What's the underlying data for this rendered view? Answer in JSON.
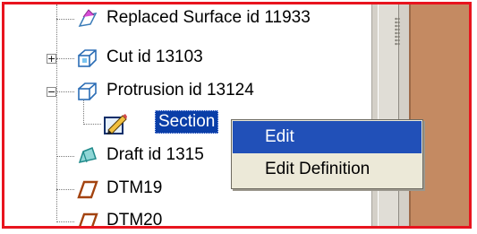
{
  "tree": {
    "items": [
      {
        "label": "Replaced Surface id 11933",
        "icon": "replaced-surface-icon"
      },
      {
        "label": "Cut id 13103",
        "icon": "cut-feature-icon",
        "expander": "+"
      },
      {
        "label": "Protrusion id 13124",
        "icon": "protrusion-feature-icon",
        "expander": "−"
      },
      {
        "label": "Section",
        "icon": "section-sketch-icon",
        "selected": true
      },
      {
        "label": "Draft id 1315",
        "icon": "draft-feature-icon"
      },
      {
        "label": "DTM19",
        "icon": "datum-plane-icon"
      },
      {
        "label": "DTM20",
        "icon": "datum-plane-icon"
      }
    ]
  },
  "context_menu": {
    "items": [
      {
        "label": "Edit",
        "highlighted": true
      },
      {
        "label": "Edit Definition",
        "highlighted": false
      }
    ]
  },
  "colors": {
    "frame": "#e8141e",
    "selection": "#0a3ea8",
    "menu_highlight": "#2150b8",
    "menu_bg": "#ece9d8",
    "side_panel": "#c48a62"
  }
}
